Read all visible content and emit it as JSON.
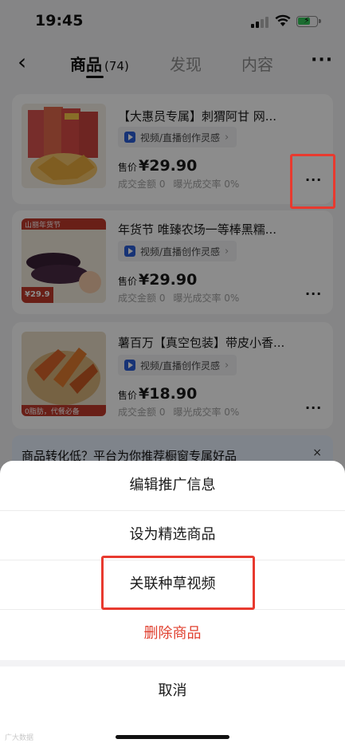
{
  "status_bar": {
    "time": "19:45"
  },
  "nav": {
    "back_icon": "chevron-left-icon",
    "tabs": [
      {
        "label": "商品",
        "count": "(74)",
        "active": true
      },
      {
        "label": "发现",
        "active": false
      },
      {
        "label": "内容",
        "active": false
      }
    ],
    "more_label": "···"
  },
  "products": [
    {
      "title": "【大惠员专属】刺猬阿甘 网...",
      "thumb_text": "",
      "chip": "视频/直播创作灵感",
      "price_label": "售价",
      "price": "¥29.90",
      "gmv": "成交金额 0",
      "ctr": "曝光成交率 0%"
    },
    {
      "title": "年货节 唯臻农场一等棒黑糯...",
      "thumb_text": "山丽年货节",
      "thumb_price": "¥29.9",
      "chip": "视频/直播创作灵感",
      "price_label": "售价",
      "price": "¥29.90",
      "gmv": "成交金额 0",
      "ctr": "曝光成交率 0%"
    },
    {
      "title": "薯百万【真空包装】带皮小香...",
      "thumb_text": "0脂肪，代餐必备",
      "chip": "视频/直播创作灵感",
      "price_label": "售价",
      "price": "¥18.90",
      "gmv": "成交金额 0",
      "ctr": "曝光成交率 0%"
    }
  ],
  "banner": {
    "text": "商品转化低？平台为你推荐橱窗专属好品",
    "close": "×"
  },
  "action_sheet": {
    "options": [
      {
        "label": "编辑推广信息",
        "danger": false
      },
      {
        "label": "设为精选商品",
        "danger": false
      },
      {
        "label": "关联种草视频",
        "danger": false
      },
      {
        "label": "删除商品",
        "danger": true
      }
    ],
    "cancel": "取消"
  },
  "watermark": "广大数据",
  "colors": {
    "danger": "#e0402f",
    "highlight": "#e83a2f",
    "accent": "#2b5dd8"
  }
}
